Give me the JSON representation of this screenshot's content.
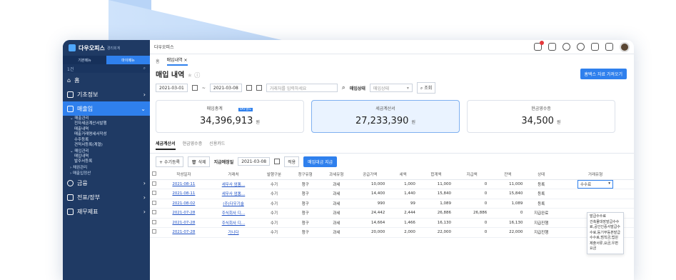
{
  "app": {
    "title": "다우오피스",
    "subtitle": "경리회계"
  },
  "sidebar": {
    "tabs": [
      "기본메뉴",
      "마이메뉴"
    ],
    "search_label": "1건",
    "items": [
      {
        "label": "홈"
      },
      {
        "label": "기초정보"
      },
      {
        "label": "매출입"
      },
      {
        "label": "금융"
      },
      {
        "label": "전표/장부"
      },
      {
        "label": "재무제표"
      }
    ],
    "sales_group": "매출관리",
    "sales_sub": [
      "전자세금계산서발행",
      "매출내역",
      "매출거래명세서작성",
      "수주등록",
      "견적서등록(계열)"
    ],
    "purchase_group": "매입관리",
    "purchase_sub": [
      "매입내역",
      "발주서등록"
    ],
    "bond_group": "채권관리",
    "sales_payment": "매출입정산"
  },
  "topbar": {
    "breadcrumb": "다우오피스"
  },
  "tabs": {
    "home": "홈",
    "current": "매입내역"
  },
  "page": {
    "title": "매입 내역",
    "import_button": "홈택스 자료 가져오기"
  },
  "filter": {
    "start_date": "2021-03-01",
    "end_date": "2021-03-08",
    "search_placeholder": "거래처를 입력하세요",
    "status_label": "매입상태",
    "status_placeholder": "매입상태",
    "query_button": "조회"
  },
  "cards": [
    {
      "label": "매입총계",
      "value": "34,396,913",
      "unit": "원",
      "tag": "VAT별도"
    },
    {
      "label": "세금계산서",
      "value": "27,233,390",
      "unit": "원"
    },
    {
      "label": "현금영수증",
      "value": "34,500",
      "unit": "원"
    }
  ],
  "subtabs": [
    "세금계산서",
    "현금영수증",
    "신용카드"
  ],
  "actions": {
    "add": "수기등록",
    "delete": "삭제",
    "due_label": "지급예정일",
    "due_date": "2021-03-08",
    "apply": "적용",
    "pay": "매입대금 지급"
  },
  "table": {
    "headers": [
      "작성일자",
      "거래처",
      "발행구분",
      "청구유형",
      "과세유형",
      "공급가액",
      "세액",
      "합계액",
      "지급액",
      "잔액",
      "상태",
      "거래유형"
    ],
    "rows": [
      [
        "2021-08-11",
        "세무사 엄뽕…",
        "수기",
        "청구",
        "과세",
        "10,000",
        "1,000",
        "11,000",
        "0",
        "11,000",
        "등록",
        "수수료"
      ],
      [
        "2021-08-11",
        "세무사 엄뽕…",
        "수기",
        "청구",
        "과세",
        "14,400",
        "1,440",
        "15,840",
        "0",
        "15,840",
        "등록",
        ""
      ],
      [
        "2021-08-02",
        "(주)다우기술",
        "수기",
        "청구",
        "과세",
        "990",
        "99",
        "1,089",
        "0",
        "1,089",
        "등록",
        ""
      ],
      [
        "2021-07-28",
        "주식회사 디…",
        "수기",
        "청구",
        "과세",
        "24,442",
        "2,444",
        "26,886",
        "26,886",
        "0",
        "지급완료",
        ""
      ],
      [
        "2021-07-28",
        "주식회사 디…",
        "수기",
        "청구",
        "과세",
        "14,664",
        "1,466",
        "16,130",
        "0",
        "16,130",
        "지급진행",
        ""
      ],
      [
        "2021-07-28",
        "가나다",
        "수기",
        "청구",
        "과세",
        "20,000",
        "2,000",
        "22,000",
        "0",
        "22,000",
        "지급진행",
        ""
      ]
    ]
  },
  "dropdown_options": [
    "발급수수료",
    "건축물대장발급수수료,공인인증서발급수수료,등기부등본발급수수료,범칙금,법원제출서류,요금,우편요금"
  ]
}
